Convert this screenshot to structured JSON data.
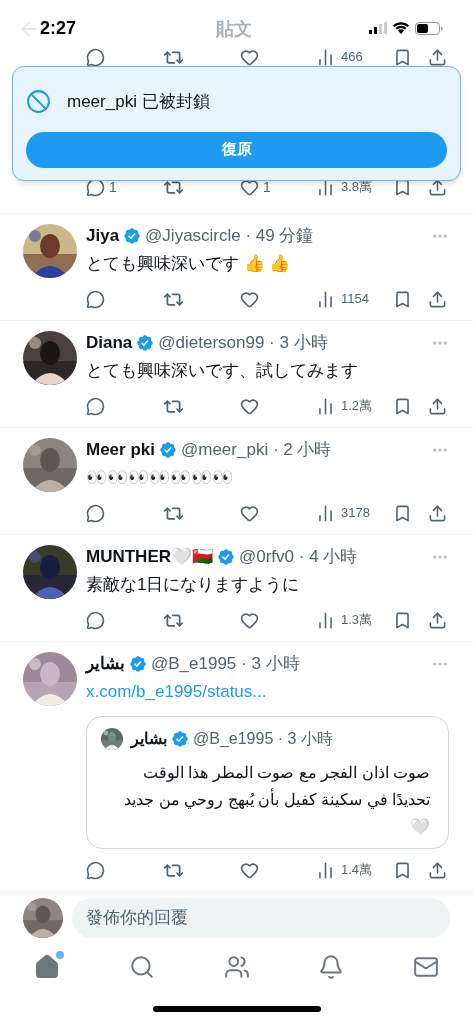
{
  "status_bar": {
    "time": "2:27"
  },
  "header": {
    "title": "貼文"
  },
  "toast": {
    "message": "meer_pki 已被封鎖",
    "button": "復原"
  },
  "top_rows": [
    {
      "views": "466"
    },
    {
      "replies": "1",
      "likes": "1",
      "views": "3.8萬"
    }
  ],
  "tweets": [
    {
      "kind": "text",
      "name": "Jiya",
      "meta": "@Jiyascircle · 49 分鐘",
      "text": "とても興味深いです 👍 👍",
      "actions": {
        "views": "1154"
      }
    },
    {
      "kind": "text",
      "name": "Diana",
      "meta": "@dieterson99 · 3 小時",
      "text": "とても興味深いです、試してみます",
      "actions": {
        "views": "1.2萬"
      }
    },
    {
      "kind": "text",
      "name": "Meer pki",
      "meta": "@meer_pki · 2 小時",
      "text": "👀👀👀👀👀👀👀",
      "actions": {
        "views": "3178"
      }
    },
    {
      "kind": "text",
      "name": "MUNTHER🤍🇴🇲",
      "meta": "@0rfv0 · 4 小時",
      "text": "素敵な1日になりますように",
      "actions": {
        "views": "1.3萬"
      }
    },
    {
      "kind": "quote",
      "name": "بشاير",
      "meta": "@B_e1995 · 3 小時",
      "link": "x.com/b_e1995/status...",
      "quote": {
        "name": "بشاير",
        "meta": "@B_e1995 · 3 小時",
        "text": "صوت اذان الفجر مع صوت  المطر هذا الوقت تحديدًا في سكينة كفيل بأن يُبهج روحي من جديد 🤍"
      },
      "actions": {
        "views": "1.4萬"
      }
    }
  ],
  "reply": {
    "placeholder": "發佈你的回覆"
  },
  "nav": [
    {
      "kind": "home",
      "selected": true,
      "dot": true
    },
    {
      "kind": "search",
      "selected": false,
      "dot": false
    },
    {
      "kind": "people",
      "selected": false,
      "dot": false
    },
    {
      "kind": "bell",
      "selected": false,
      "dot": false
    },
    {
      "kind": "mail",
      "selected": false,
      "dot": false
    }
  ]
}
